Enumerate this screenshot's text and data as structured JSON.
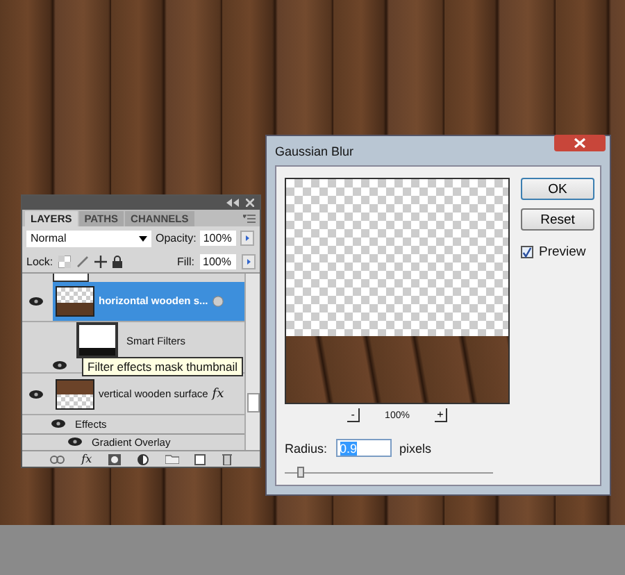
{
  "layers_panel": {
    "tabs": [
      {
        "label": "LAYERS",
        "selected": true
      },
      {
        "label": "PATHS",
        "selected": false
      },
      {
        "label": "CHANNELS",
        "selected": false
      }
    ],
    "blend_mode": "Normal",
    "opacity_label": "Opacity:",
    "opacity": "100%",
    "lock_label": "Lock:",
    "fill_label": "Fill:",
    "fill": "100%",
    "layers": [
      {
        "name": "horizontal wooden s...",
        "selected": true,
        "children": [
          {
            "kind": "smart-filters",
            "name": "Smart Filters"
          }
        ]
      },
      {
        "name": "vertical wooden surface",
        "selected": false,
        "fx": "fx",
        "children": [
          {
            "kind": "effects",
            "name": "Effects",
            "children": [
              {
                "kind": "effect",
                "name": "Gradient Overlay"
              }
            ]
          }
        ]
      }
    ],
    "toolbar_fx": "fx",
    "tooltip": "Filter effects mask thumbnail"
  },
  "dialog": {
    "title": "Gaussian Blur",
    "buttons": [
      "OK",
      "Reset"
    ],
    "preview": {
      "label": "Preview",
      "checked": true
    },
    "zoom_out": "-",
    "zoom": "100%",
    "zoom_in": "+",
    "radius_label": "Radius:",
    "radius": "0.9",
    "unit": "pixels",
    "slider": {
      "level": 0.06
    }
  }
}
